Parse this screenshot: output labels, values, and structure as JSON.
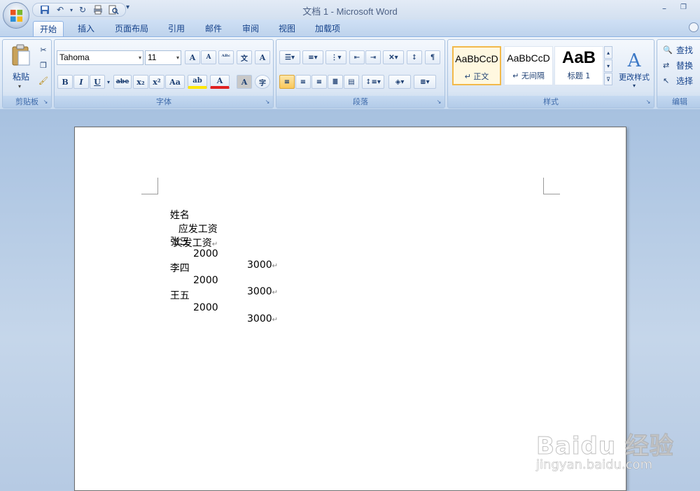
{
  "window": {
    "title": "文档 1 - Microsoft Word",
    "minimize": "–",
    "restore": "❐"
  },
  "qat": {
    "save": "save-icon",
    "undo": "undo-icon",
    "redo": "redo-icon",
    "print": "print-icon",
    "preview": "print-preview-icon"
  },
  "tabs": [
    "开始",
    "插入",
    "页面布局",
    "引用",
    "邮件",
    "审阅",
    "视图",
    "加载项"
  ],
  "ribbon": {
    "clipboard": {
      "label": "剪贴板",
      "paste": "粘贴"
    },
    "font": {
      "label": "字体",
      "font_name": "Tahoma",
      "font_size": "11",
      "grow": "A",
      "shrink": "A",
      "bold": "B",
      "italic": "I",
      "underline": "U",
      "strike": "abe",
      "subscript": "x₂",
      "superscript": "x²",
      "change_case": "Aa",
      "highlight": "ab",
      "font_color": "A",
      "char_shading": "A",
      "enclose": "字",
      "phonetic": "文",
      "clear": "A"
    },
    "paragraph": {
      "label": "段落"
    },
    "styles": {
      "label": "样式",
      "items": [
        {
          "sample": "AaBbCcD",
          "name": "↵ 正文"
        },
        {
          "sample": "AaBbCcD",
          "name": "↵ 无间隔"
        },
        {
          "sample": "AaB",
          "name": "标题 1"
        }
      ],
      "change_styles": "更改样式"
    },
    "editing": {
      "label": "编辑",
      "find": "查找",
      "replace": "替换",
      "select": "选择"
    }
  },
  "document": {
    "rows": [
      {
        "name": "姓名",
        "due": "应发工资",
        "paid": "实发工资"
      },
      {
        "name": "张三",
        "due": "2000",
        "paid": "3000"
      },
      {
        "name": "李四",
        "due": "2000",
        "paid": "3000"
      },
      {
        "name": "王五",
        "due": "2000",
        "paid": "3000"
      }
    ],
    "para_mark": "↵"
  },
  "watermark": {
    "main": "Baidu 经验",
    "sub": "jingyan.baidu.com"
  },
  "colors": {
    "ribbon": "#dce7f5",
    "tab_text": "#15428b",
    "workspace": "#b6cae3",
    "accent": "#f9c75a"
  }
}
